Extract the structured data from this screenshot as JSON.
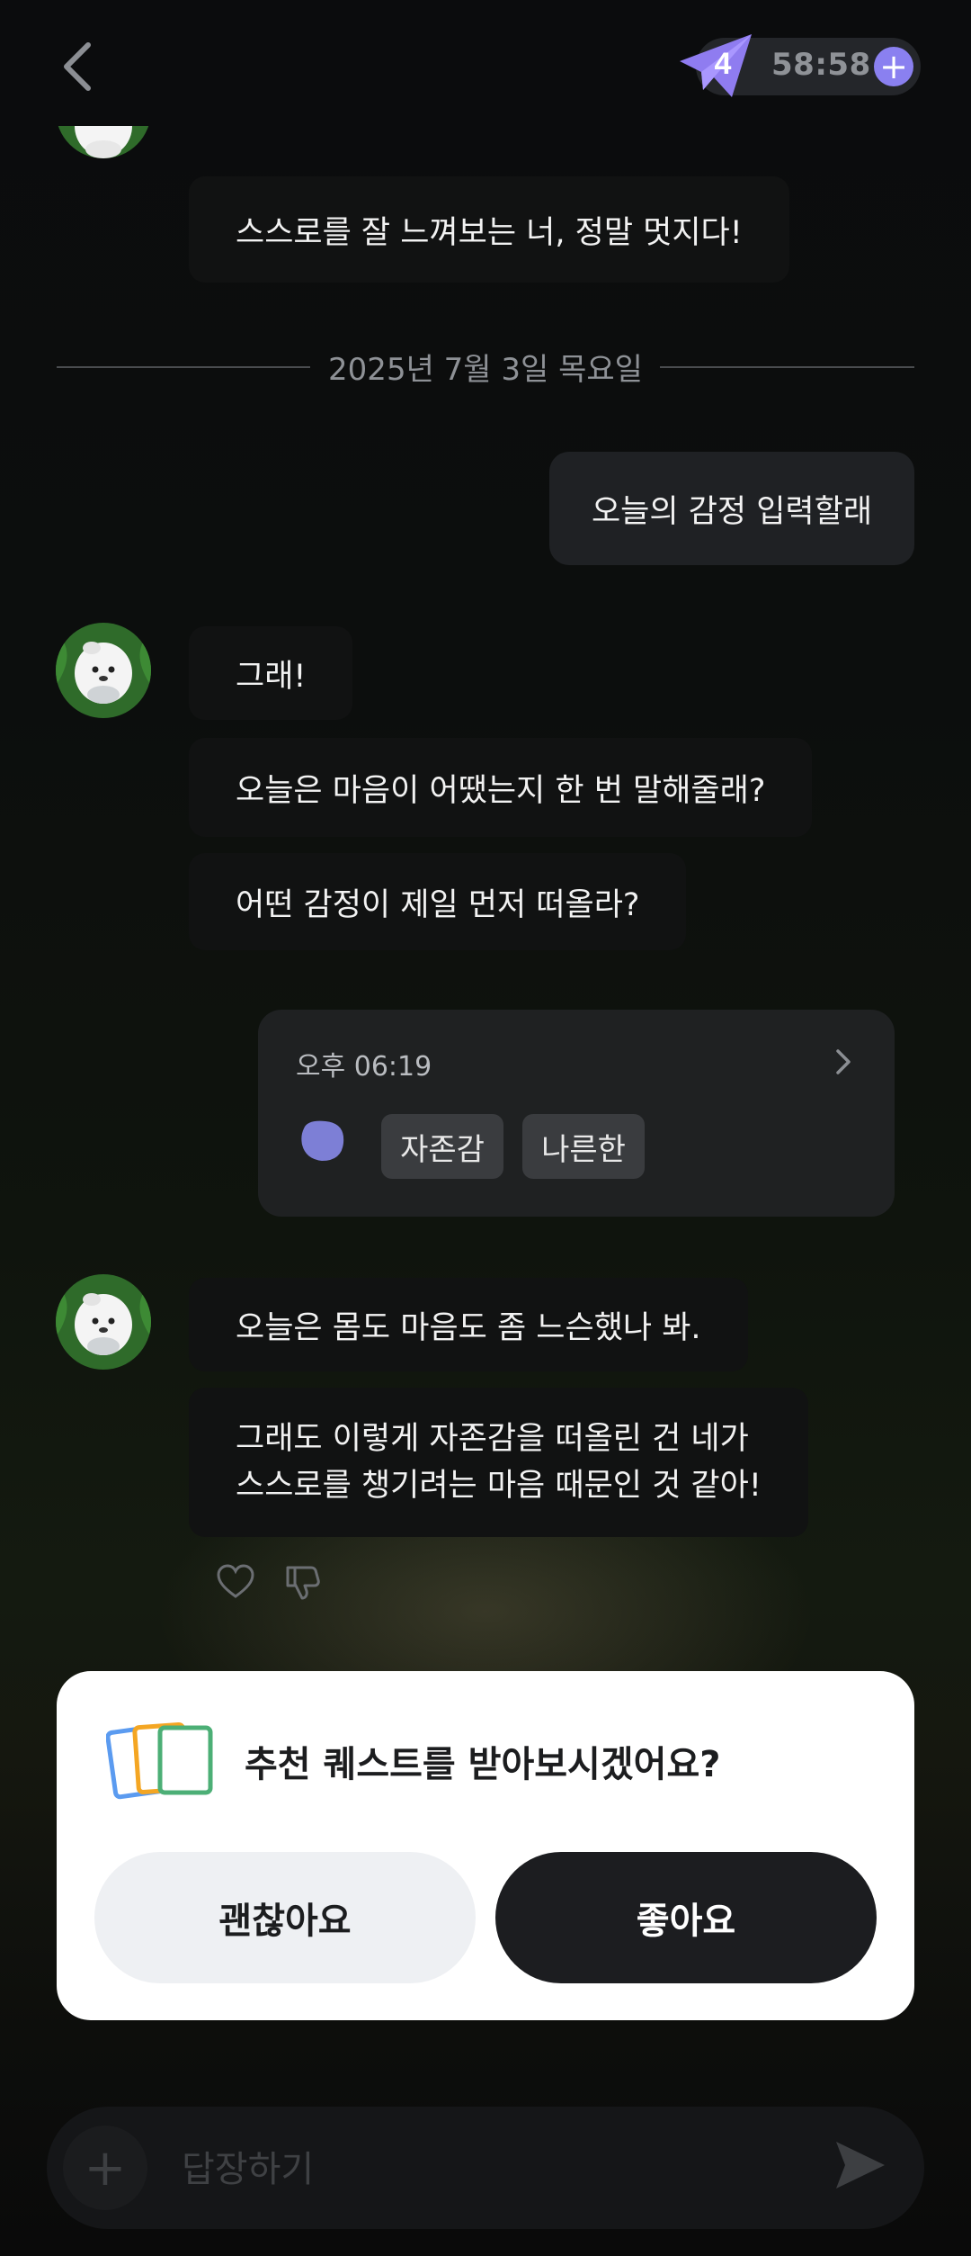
{
  "header": {
    "back_icon": "chevron-left-icon",
    "badge_count": "4",
    "timer": "58:58",
    "plus_label": "+"
  },
  "chat": {
    "top_message": "스스로를 잘 느껴보는 너, 정말 멋지다!",
    "date_divider": "2025년 7월 3일 목요일",
    "user_message": "오늘의 감정 입력할래",
    "bot_group_1": [
      "그래!",
      "오늘은 마음이 어땠는지 한 번 말해줄래?",
      "어떤 감정이 제일 먼저 떠올라?"
    ],
    "mood_card": {
      "time": "오후 06:19",
      "color": "#7d7fd6",
      "tags": [
        "자존감",
        "나른한"
      ]
    },
    "bot_group_2": {
      "line1": "오늘은 몸도 마음도 좀 느슨했나 봐.",
      "line2a": "그래도 이렇게 자존감을 떠올린 건 네가",
      "line2b": "스스로를 챙기려는 마음 때문인 것 같아!"
    }
  },
  "quest_modal": {
    "text": "추천 퀘스트를 받아보시겠어요?",
    "decline_label": "괜찮아요",
    "accept_label": "좋아요"
  },
  "reply": {
    "placeholder": "답장하기"
  },
  "colors": {
    "accent": "#8a80f0",
    "modal_bg": "#ffffff",
    "accept_bg": "#1c1d20"
  }
}
